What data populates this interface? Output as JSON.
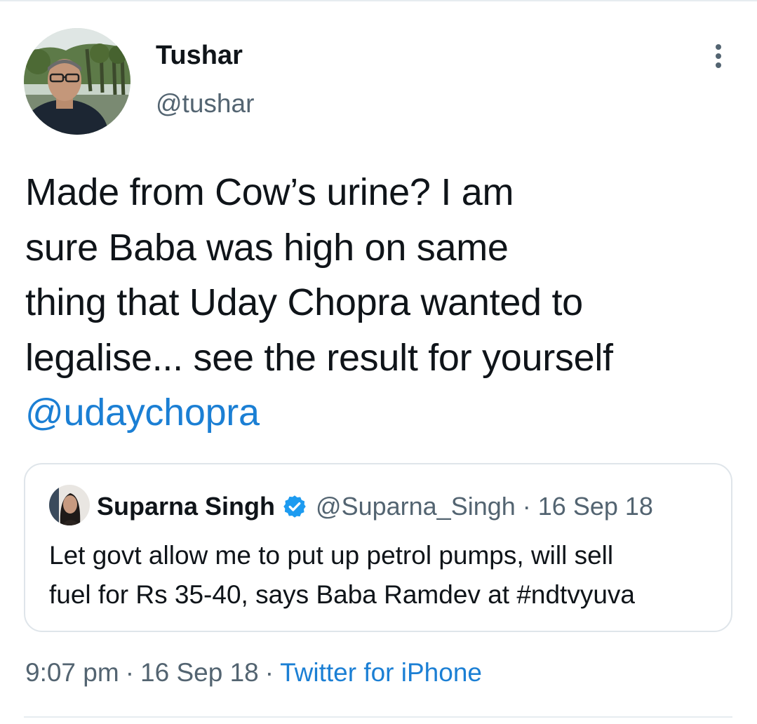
{
  "author": {
    "name": "Tushar",
    "handle": "@tushar"
  },
  "tweet": {
    "lines": [
      "Made from Cow’s urine? I am",
      "sure Baba was high on same",
      "thing that Uday Chopra wanted to",
      "legalise... see the result for yourself"
    ],
    "mention": "@udaychopra"
  },
  "quoted_tweet": {
    "name": "Suparna Singh",
    "handle": "@Suparna_Singh",
    "separator": "·",
    "date": "16 Sep 18",
    "lines": [
      "Let govt allow me to put up petrol pumps, will sell",
      "fuel for Rs 35-40, says Baba Ramdev at #ndtvyuva"
    ]
  },
  "meta": {
    "time": "9:07 pm",
    "date": "16 Sep 18",
    "separator": "·",
    "source": "Twitter for iPhone"
  },
  "icons": {
    "more": "more-vertical-icon",
    "verified": "verified-badge-icon"
  },
  "colors": {
    "link": "#1b7fd4",
    "secondary_text": "#536471",
    "primary_text": "#0f1419",
    "border": "#dfe5ea",
    "verified": "#1d9bf0"
  }
}
